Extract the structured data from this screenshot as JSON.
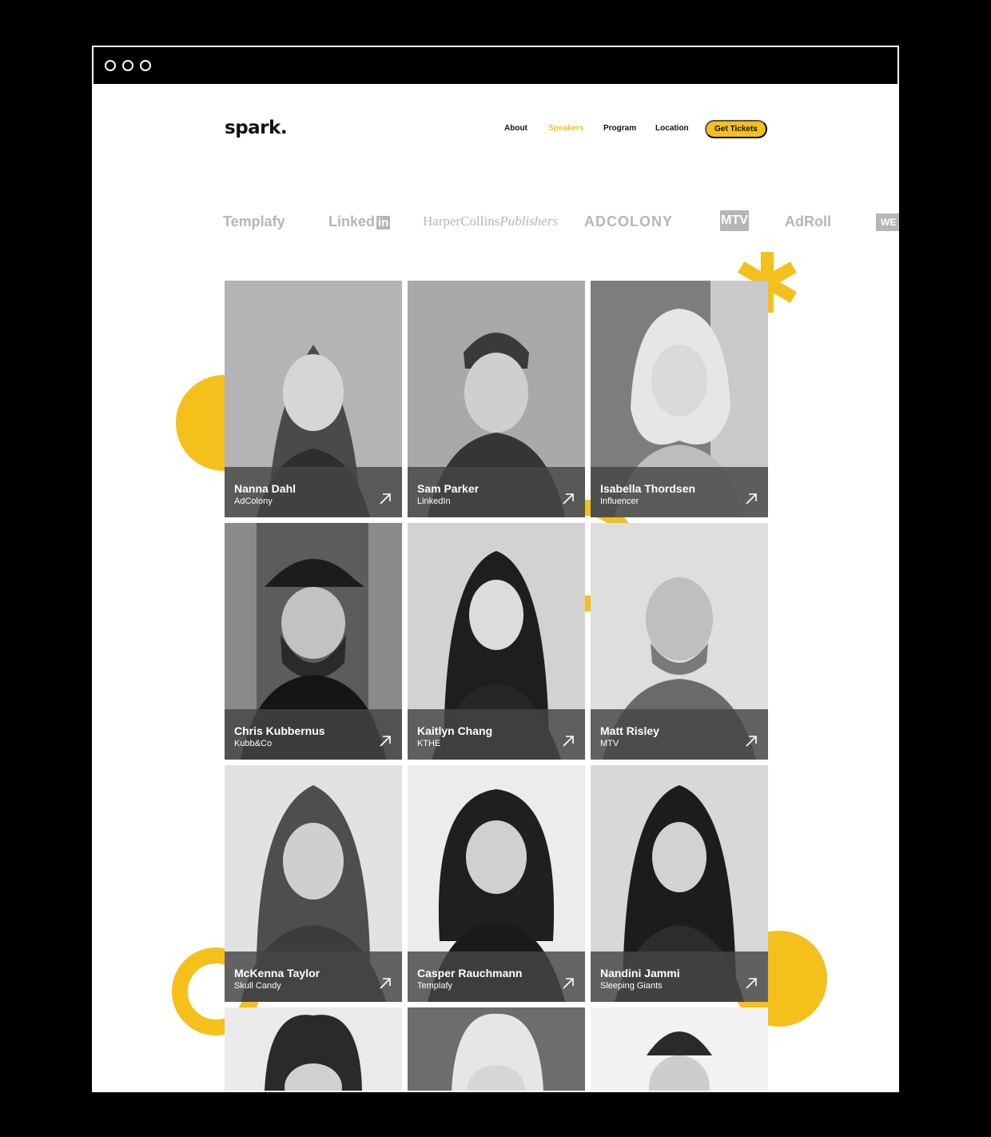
{
  "brand": {
    "logo": "spark.",
    "accent": "#f5bf1c"
  },
  "nav": {
    "items": [
      {
        "label": "About",
        "active": false
      },
      {
        "label": "Speakers",
        "active": true
      },
      {
        "label": "Program",
        "active": false
      },
      {
        "label": "Location",
        "active": false
      }
    ],
    "cta": "Get Tickets"
  },
  "partners": [
    "Templafy",
    "Linked",
    "in",
    "HarperCollins",
    "Publishers",
    "ADCOLONY",
    "MTV",
    "AdRoll",
    "WE"
  ],
  "speakers": [
    {
      "name": "Nanna Dahl",
      "company": "AdColony",
      "icon": "arrow-up-right-icon"
    },
    {
      "name": "Sam Parker",
      "company": "LinkedIn",
      "icon": "arrow-up-right-icon"
    },
    {
      "name": "Isabella Thordsen",
      "company": "Influencer",
      "icon": "arrow-up-right-icon"
    },
    {
      "name": "Chris Kubbernus",
      "company": "Kubb&Co",
      "icon": "arrow-up-right-icon"
    },
    {
      "name": "Kaitlyn Chang",
      "company": "KTHE",
      "icon": "arrow-up-right-icon"
    },
    {
      "name": "Matt Risley",
      "company": "MTV",
      "icon": "arrow-up-right-icon"
    },
    {
      "name": "McKenna Taylor",
      "company": "Skull Candy",
      "icon": "arrow-up-right-icon"
    },
    {
      "name": "Casper Rauchmann",
      "company": "Templafy",
      "icon": "arrow-up-right-icon"
    },
    {
      "name": "Nandini Jammi",
      "company": "Sleeping Giants",
      "icon": "arrow-up-right-icon"
    }
  ]
}
